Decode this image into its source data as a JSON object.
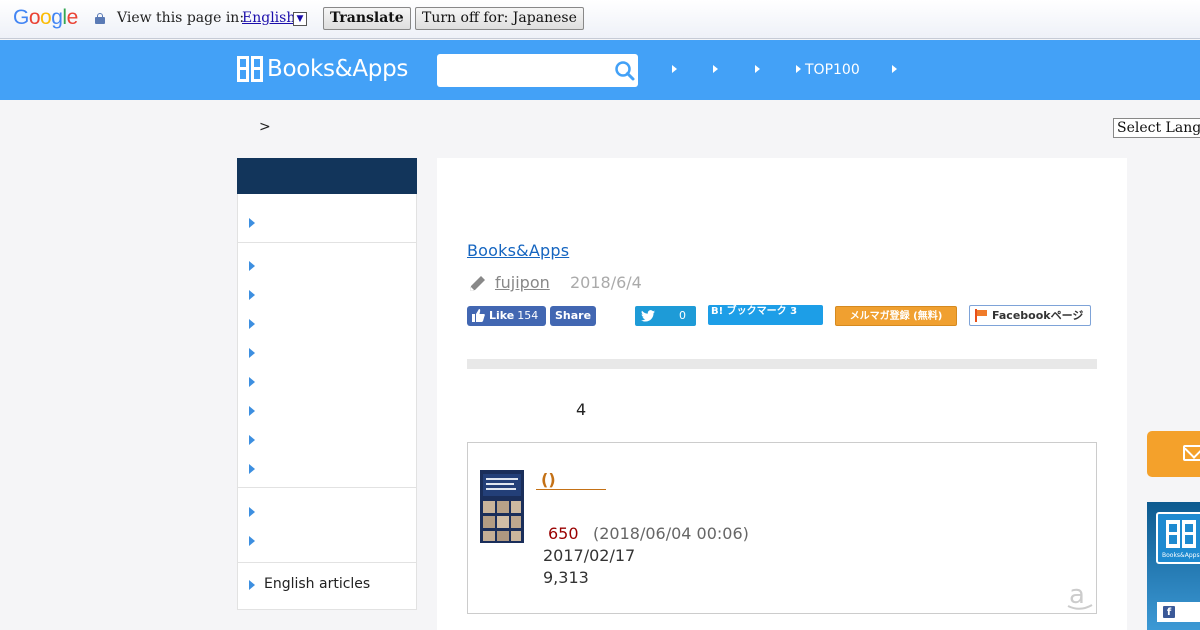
{
  "translate_bar": {
    "logo_letters": [
      "G",
      "o",
      "o",
      "g",
      "l",
      "e"
    ],
    "logo_colors": [
      "#4285f4",
      "#ea4335",
      "#fbbc05",
      "#4285f4",
      "#34a853",
      "#ea4335"
    ],
    "view_label": "View this page in:",
    "language": "English",
    "dropdown_glyph": "▼",
    "translate_button": "Translate",
    "turn_off_button": "Turn off for: Japanese"
  },
  "header": {
    "logo_text": "Books&Apps",
    "brand_color": "#43a1f7",
    "search_placeholder": "",
    "nav_items": [
      {
        "label": ""
      },
      {
        "label": ""
      },
      {
        "label": ""
      },
      {
        "label": "TOP100"
      },
      {
        "label": ""
      }
    ]
  },
  "breadcrumb": {
    "separator": ">"
  },
  "language_select": {
    "value": "Select Language"
  },
  "sidebar": {
    "header_color": "#12355b",
    "groups": [
      [
        {
          "label": ""
        }
      ],
      [
        {
          "label": ""
        },
        {
          "label": ""
        },
        {
          "label": ""
        },
        {
          "label": ""
        },
        {
          "label": ""
        },
        {
          "label": ""
        },
        {
          "label": ""
        },
        {
          "label": ""
        }
      ],
      [
        {
          "label": ""
        },
        {
          "label": ""
        }
      ],
      [
        {
          "label": "English articles"
        }
      ]
    ]
  },
  "article": {
    "title": "Books&Apps",
    "author": "fujipon",
    "date": "2018/6/4",
    "social": {
      "fb_like_label": "Like",
      "fb_like_count": "154",
      "fb_share_label": "Share",
      "tweet_count": "0",
      "hatena_label": "B! ブックマーク 3",
      "mailmag_label": "メルマガ登録 (無料)",
      "facebook_page_label": "Facebookページ"
    },
    "paragraph_number": "4"
  },
  "product": {
    "title": "()",
    "price": "650",
    "price_date": "(2018/06/04 00:06)",
    "publish_date": "2017/02/17",
    "rank": "9,313",
    "amazon_glyph": "a"
  },
  "right_float": {
    "ad_logo_text": "Books&Apps",
    "fb_glyph": "f"
  }
}
